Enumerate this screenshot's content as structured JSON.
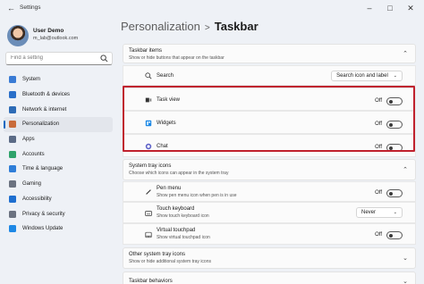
{
  "window": {
    "title": "Settings"
  },
  "user": {
    "name": "User Demo",
    "email": "m_lab@outlook.com"
  },
  "search": {
    "placeholder": "Find a setting"
  },
  "sidebar": {
    "items": [
      {
        "label": "System",
        "color": "#3a7bd5"
      },
      {
        "label": "Bluetooth & devices",
        "color": "#2a6fc9"
      },
      {
        "label": "Network & internet",
        "color": "#2d6bb6"
      },
      {
        "label": "Personalization",
        "color": "#c96b3a",
        "active": true
      },
      {
        "label": "Apps",
        "color": "#5b6b86"
      },
      {
        "label": "Accounts",
        "color": "#2fa36b"
      },
      {
        "label": "Time & language",
        "color": "#2f7ed8"
      },
      {
        "label": "Gaming",
        "color": "#6b7280"
      },
      {
        "label": "Accessibility",
        "color": "#1f6fd0"
      },
      {
        "label": "Privacy & security",
        "color": "#6b7280"
      },
      {
        "label": "Windows Update",
        "color": "#1e88e5"
      }
    ]
  },
  "breadcrumb": {
    "parent": "Personalization",
    "separator": ">",
    "current": "Taskbar"
  },
  "taskbar_items": {
    "title": "Taskbar items",
    "subtitle": "Show or hide buttons that appear on the taskbar",
    "search_label": "Search",
    "search_value": "Search icon and label",
    "rows": [
      {
        "label": "Task view",
        "state": "Off"
      },
      {
        "label": "Widgets",
        "state": "Off"
      },
      {
        "label": "Chat",
        "state": "Off"
      }
    ]
  },
  "tray_icons": {
    "title": "System tray icons",
    "subtitle": "Choose which icons can appear in the system tray",
    "pen": {
      "label": "Pen menu",
      "sub": "Show pen menu icon when pen is in use",
      "state": "Off"
    },
    "keyboard": {
      "label": "Touch keyboard",
      "sub": "Show touch keyboard icon",
      "value": "Never"
    },
    "touchpad": {
      "label": "Virtual touchpad",
      "sub": "Show virtual touchpad icon",
      "state": "Off"
    }
  },
  "other_tray": {
    "title": "Other system tray icons",
    "subtitle": "Show or hide additional system tray icons"
  },
  "behaviors": {
    "title": "Taskbar behaviors"
  },
  "accent": "#0067c0",
  "highlight_color": "#c0212e"
}
